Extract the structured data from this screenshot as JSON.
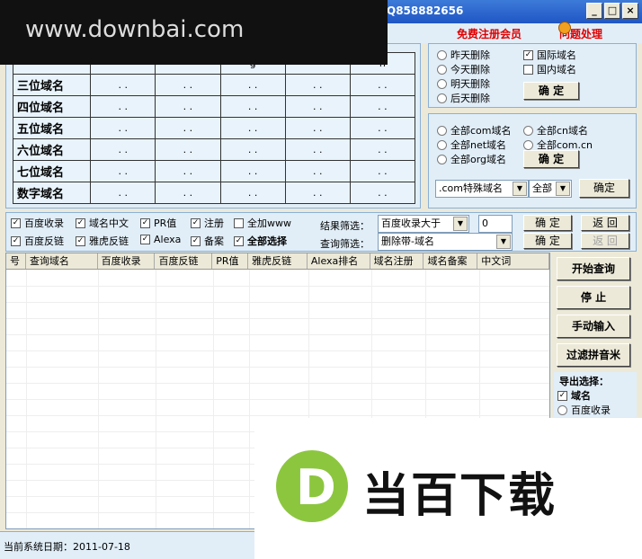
{
  "window": {
    "title_qq": "Q858882656",
    "register_link": "免费注册会员",
    "help_label": "问题处理"
  },
  "overlay_banner": "www.downbai.com",
  "grid": {
    "header_partial": [
      "",
      "",
      "",
      "g",
      "",
      "n"
    ],
    "rows": [
      {
        "label": "三位域名",
        "cells": [
          ". .",
          ". .",
          ". .",
          ". .",
          ". ."
        ]
      },
      {
        "label": "四位域名",
        "cells": [
          ". .",
          ". .",
          ". .",
          ". .",
          ". ."
        ]
      },
      {
        "label": "五位域名",
        "cells": [
          ". .",
          ". .",
          ". .",
          ". .",
          ". ."
        ]
      },
      {
        "label": "六位域名",
        "cells": [
          ". .",
          ". .",
          ". .",
          ". .",
          ". ."
        ]
      },
      {
        "label": "七位域名",
        "cells": [
          ". .",
          ". .",
          ". .",
          ". .",
          ". ."
        ]
      },
      {
        "label": "数字域名",
        "cells": [
          ". .",
          ". .",
          ". .",
          ". .",
          ". ."
        ]
      }
    ]
  },
  "delete_options": {
    "radios": [
      "昨天删除",
      "今天删除",
      "明天删除",
      "后天删除"
    ],
    "checkboxes": [
      {
        "label": "国际域名",
        "checked": true
      },
      {
        "label": "国内域名",
        "checked": false
      }
    ],
    "confirm": "确 定"
  },
  "domain_scope": {
    "radios": [
      "全部com域名",
      "全部cn域名",
      "全部net域名",
      "全部com.cn",
      "全部org域名"
    ],
    "confirm": "确 定",
    "special_select": ".com特殊域名",
    "all_select": "全部",
    "confirm2": "确定"
  },
  "query_options": {
    "checkboxes_row1": [
      {
        "label": "百度收录",
        "checked": true
      },
      {
        "label": "域名中文",
        "checked": true
      },
      {
        "label": "PR值",
        "checked": true
      },
      {
        "label": "注册",
        "checked": true
      },
      {
        "label": "全加www",
        "checked": false
      }
    ],
    "checkboxes_row2": [
      {
        "label": "百度反链",
        "checked": true
      },
      {
        "label": "雅虎反链",
        "checked": true
      },
      {
        "label": "Alexa",
        "checked": true
      },
      {
        "label": "备案",
        "checked": true
      },
      {
        "label": "全部选择",
        "checked": true
      }
    ],
    "result_filter_label": "结果筛选：",
    "result_filter_value": "百度收录大于",
    "result_filter_number": "0",
    "query_filter_label": "查询筛选：",
    "query_filter_value": "删除带-域名",
    "confirm_a": "确 定",
    "back_a": "返 回",
    "confirm_b": "确 定",
    "back_b": "返 回"
  },
  "table": {
    "columns": [
      "号",
      "查询域名",
      "百度收录",
      "百度反链",
      "PR值",
      "雅虎反链",
      "Alexa排名",
      "域名注册",
      "域名备案",
      "中文词"
    ]
  },
  "side_buttons": {
    "start": "开始查询",
    "stop": "停  止",
    "manual": "手动输入",
    "filter": "过滤拼音米"
  },
  "export": {
    "title": "导出选择：",
    "domain": "域名",
    "baidu": "百度收录"
  },
  "status": {
    "date_label": "当前系统日期：2011-07-18"
  },
  "watermark": {
    "logo_letter": "D",
    "text": "当百下载"
  }
}
